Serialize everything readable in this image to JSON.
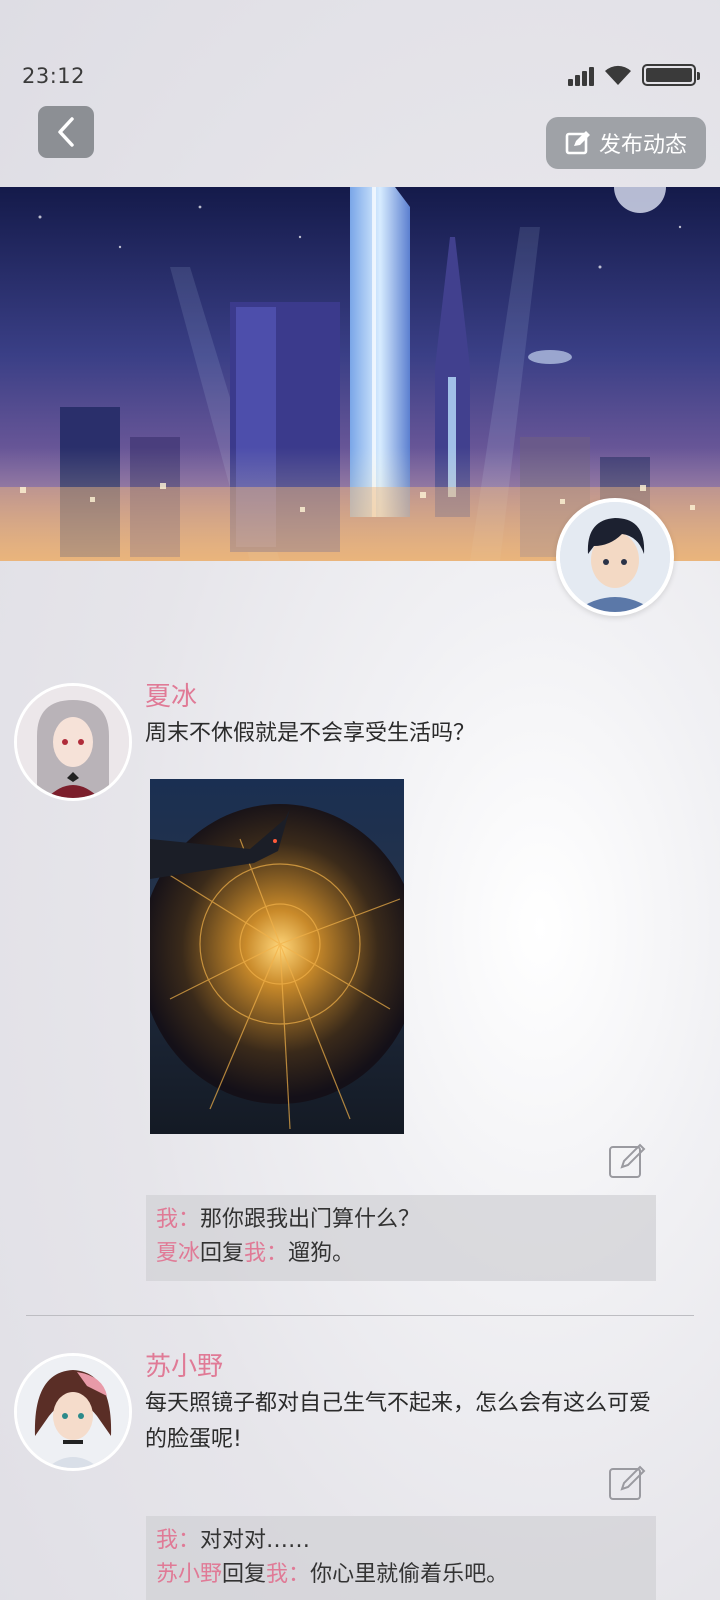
{
  "status_bar": {
    "time": "23:12"
  },
  "header": {
    "post_label": "发布动态"
  },
  "posts": [
    {
      "author": "夏冰",
      "text": "周末不休假就是不会享受生活吗？",
      "comments": [
        {
          "from": "我",
          "sep": "：",
          "text": "那你跟我出门算什么？"
        },
        {
          "from": "夏冰",
          "reply_word": "回复",
          "to": "我",
          "sep": "：",
          "text": "遛狗。"
        }
      ]
    },
    {
      "author": "苏小野",
      "text": "每天照镜子都对自己生气不起来，怎么会有这么可爱的脸蛋呢!",
      "comments": [
        {
          "from": "我",
          "sep": "：",
          "text": "对对对……"
        },
        {
          "from": "苏小野",
          "reply_word": "回复",
          "to": "我",
          "sep": "：",
          "text": "你心里就偷着乐吧。"
        }
      ]
    }
  ],
  "colors": {
    "name_pink": "#e07a96",
    "button_gray": "#9fa2a7"
  },
  "icons": [
    "signal-icon",
    "wifi-icon",
    "battery-icon",
    "back-arrow-icon",
    "edit-icon",
    "comment-icon"
  ]
}
